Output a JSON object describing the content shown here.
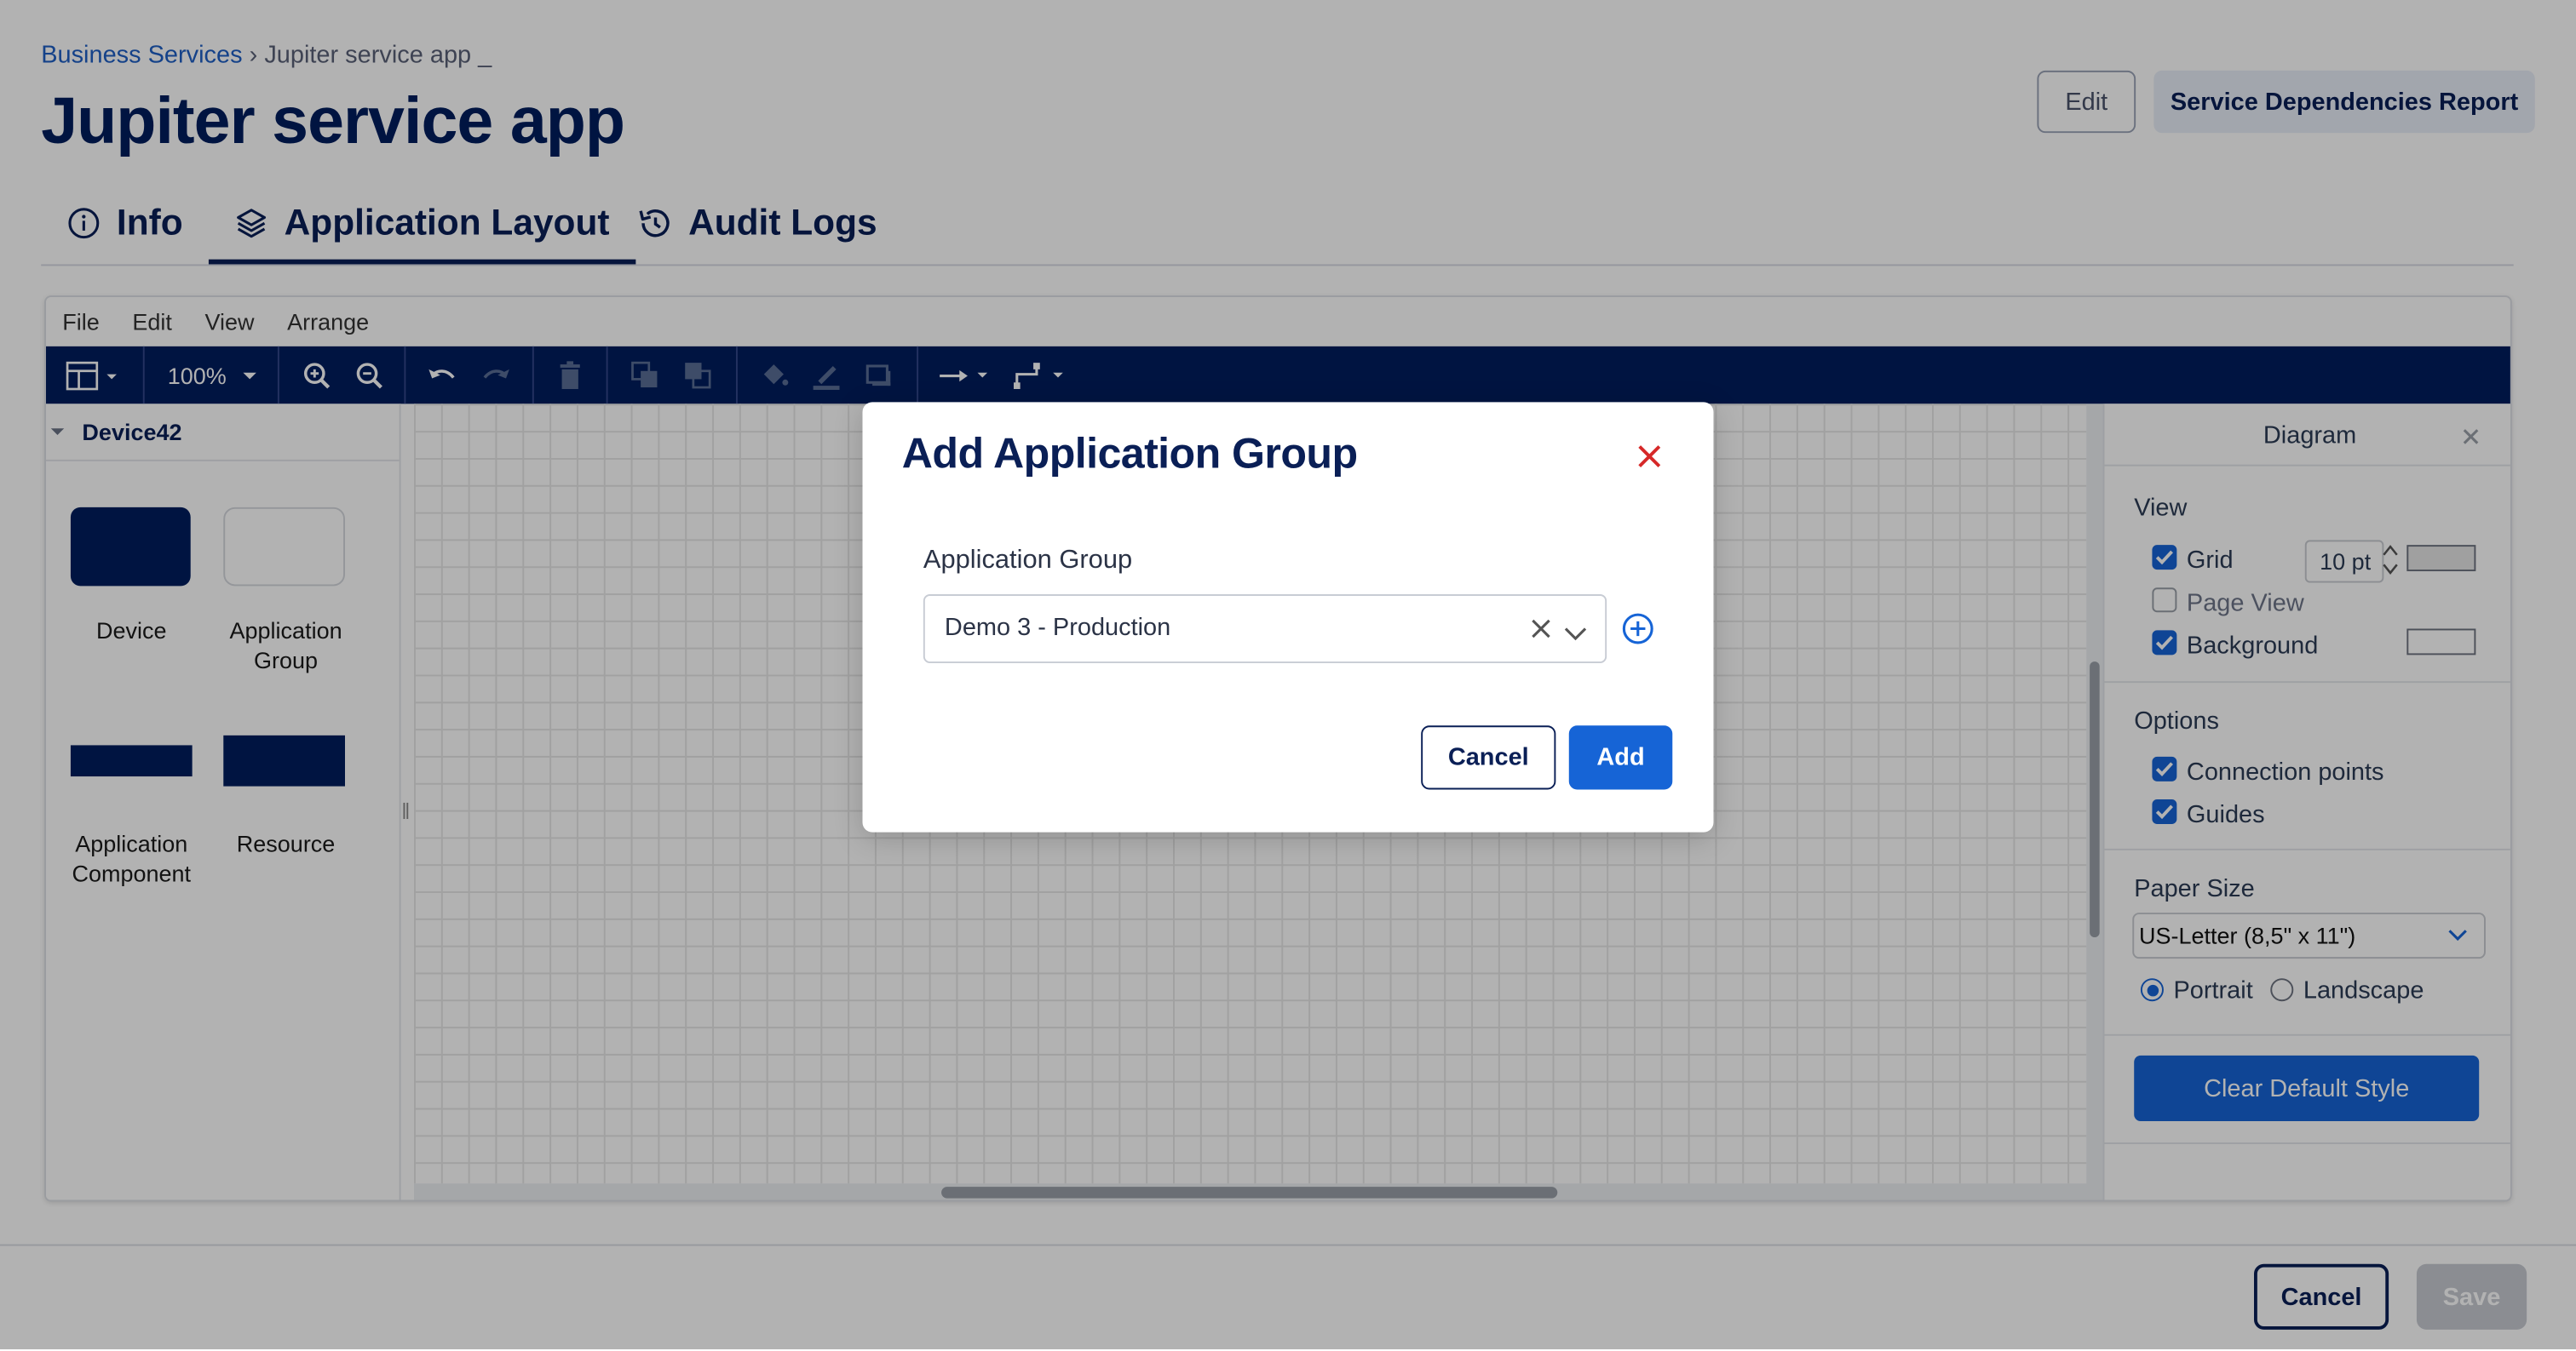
{
  "breadcrumb": {
    "parent": "Business Services",
    "separator": "›",
    "current": "Jupiter service app _"
  },
  "page": {
    "title": "Jupiter service app"
  },
  "header_actions": {
    "edit_label": "Edit",
    "report_label": "Service Dependencies Report"
  },
  "tabs": [
    {
      "label": "Info",
      "icon": "info-icon",
      "active": false
    },
    {
      "label": "Application Layout",
      "icon": "layers-icon",
      "active": true
    },
    {
      "label": "Audit Logs",
      "icon": "history-icon",
      "active": false
    }
  ],
  "editor": {
    "menu": [
      "File",
      "Edit",
      "View",
      "Arrange"
    ],
    "toolbar": {
      "zoom": "100%"
    },
    "library": {
      "title": "Device42",
      "shapes": [
        {
          "label": "Device"
        },
        {
          "label": "Application Group"
        },
        {
          "label": "Application Component"
        },
        {
          "label": "Resource"
        }
      ]
    },
    "format_panel": {
      "title": "Diagram",
      "view": {
        "heading": "View",
        "grid_label": "Grid",
        "grid_checked": true,
        "grid_size": "10 pt",
        "page_view_label": "Page View",
        "page_view_checked": false,
        "background_label": "Background",
        "background_checked": true
      },
      "options": {
        "heading": "Options",
        "connection_points_label": "Connection points",
        "connection_points_checked": true,
        "guides_label": "Guides",
        "guides_checked": true
      },
      "paper": {
        "heading": "Paper Size",
        "selected": "US-Letter (8,5\" x 11\")",
        "portrait_label": "Portrait",
        "landscape_label": "Landscape",
        "orientation": "Portrait"
      },
      "clear_style_label": "Clear Default Style"
    }
  },
  "footer": {
    "cancel_label": "Cancel",
    "save_label": "Save"
  },
  "modal": {
    "title": "Add Application Group",
    "field_label": "Application Group",
    "selected_value": "Demo 3 - Production",
    "cancel_label": "Cancel",
    "add_label": "Add"
  },
  "colors": {
    "brand_navy": "#001e5e",
    "primary_blue": "#1664d6",
    "link_blue": "#1f5fc4",
    "close_red": "#d62828"
  }
}
